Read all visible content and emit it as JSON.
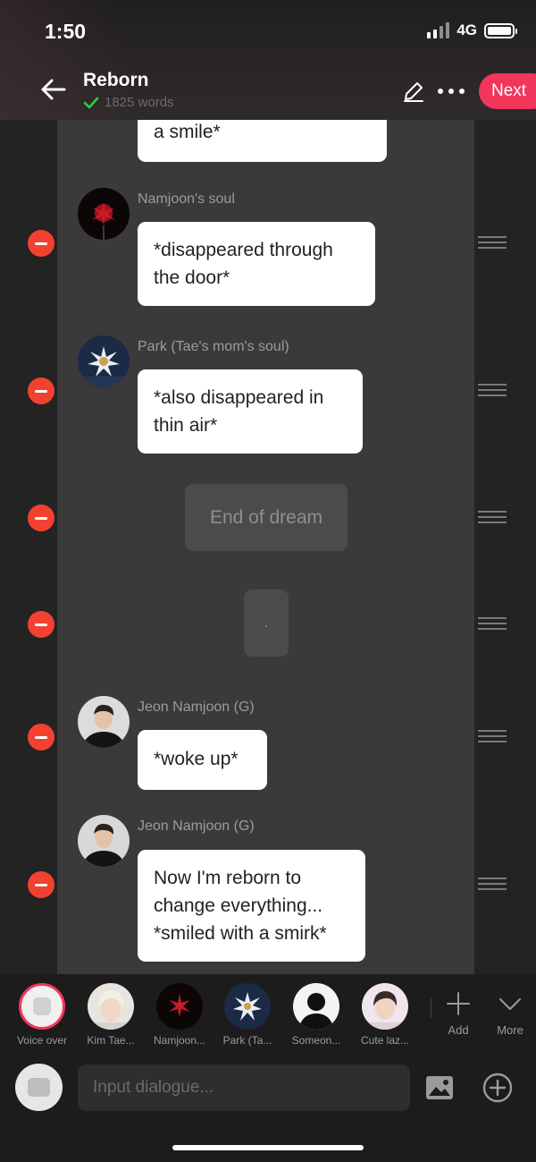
{
  "status": {
    "time": "1:50",
    "network": "4G"
  },
  "header": {
    "title": "Reborn",
    "word_count": "1825 words",
    "next_label": "Next"
  },
  "messages": [
    {
      "type": "bubble",
      "text_lines": [
        "a smile*"
      ]
    },
    {
      "type": "bubble",
      "speaker": "Namjoon's soul",
      "avatar": "red-flower",
      "text_lines": [
        "*disappeared through",
        "the door*"
      ]
    },
    {
      "type": "bubble",
      "speaker": "Park (Tae's mom's soul)",
      "avatar": "white-flower",
      "text_lines": [
        "*also disappeared in",
        "thin air*"
      ]
    },
    {
      "type": "narration",
      "text": "End of dream"
    },
    {
      "type": "narration",
      "text": "."
    },
    {
      "type": "bubble",
      "speaker": "Jeon Namjoon (G)",
      "avatar": "man-black",
      "text_lines": [
        "*woke up*"
      ]
    },
    {
      "type": "bubble",
      "speaker": "Jeon Namjoon (G)",
      "avatar": "man-black",
      "text_lines": [
        "Now I'm reborn to",
        "change everything...",
        "*smiled with a smirk*"
      ]
    }
  ],
  "characters": [
    {
      "name": "Voice over",
      "avatar": "voice-over"
    },
    {
      "name": "Kim Tae...",
      "avatar": "blond-man"
    },
    {
      "name": "Namjoon...",
      "avatar": "red-flower"
    },
    {
      "name": "Park (Ta...",
      "avatar": "white-flower"
    },
    {
      "name": "Someon...",
      "avatar": "silhouette"
    },
    {
      "name": "Cute laz...",
      "avatar": "young-man"
    }
  ],
  "tools": {
    "add_label": "Add",
    "more_label": "More"
  },
  "input": {
    "placeholder": "Input dialogue..."
  },
  "colors": {
    "accent": "#f2365b",
    "delete": "#f2412f",
    "chat_bg": "#3a3a3a",
    "page_bg": "#232323"
  }
}
